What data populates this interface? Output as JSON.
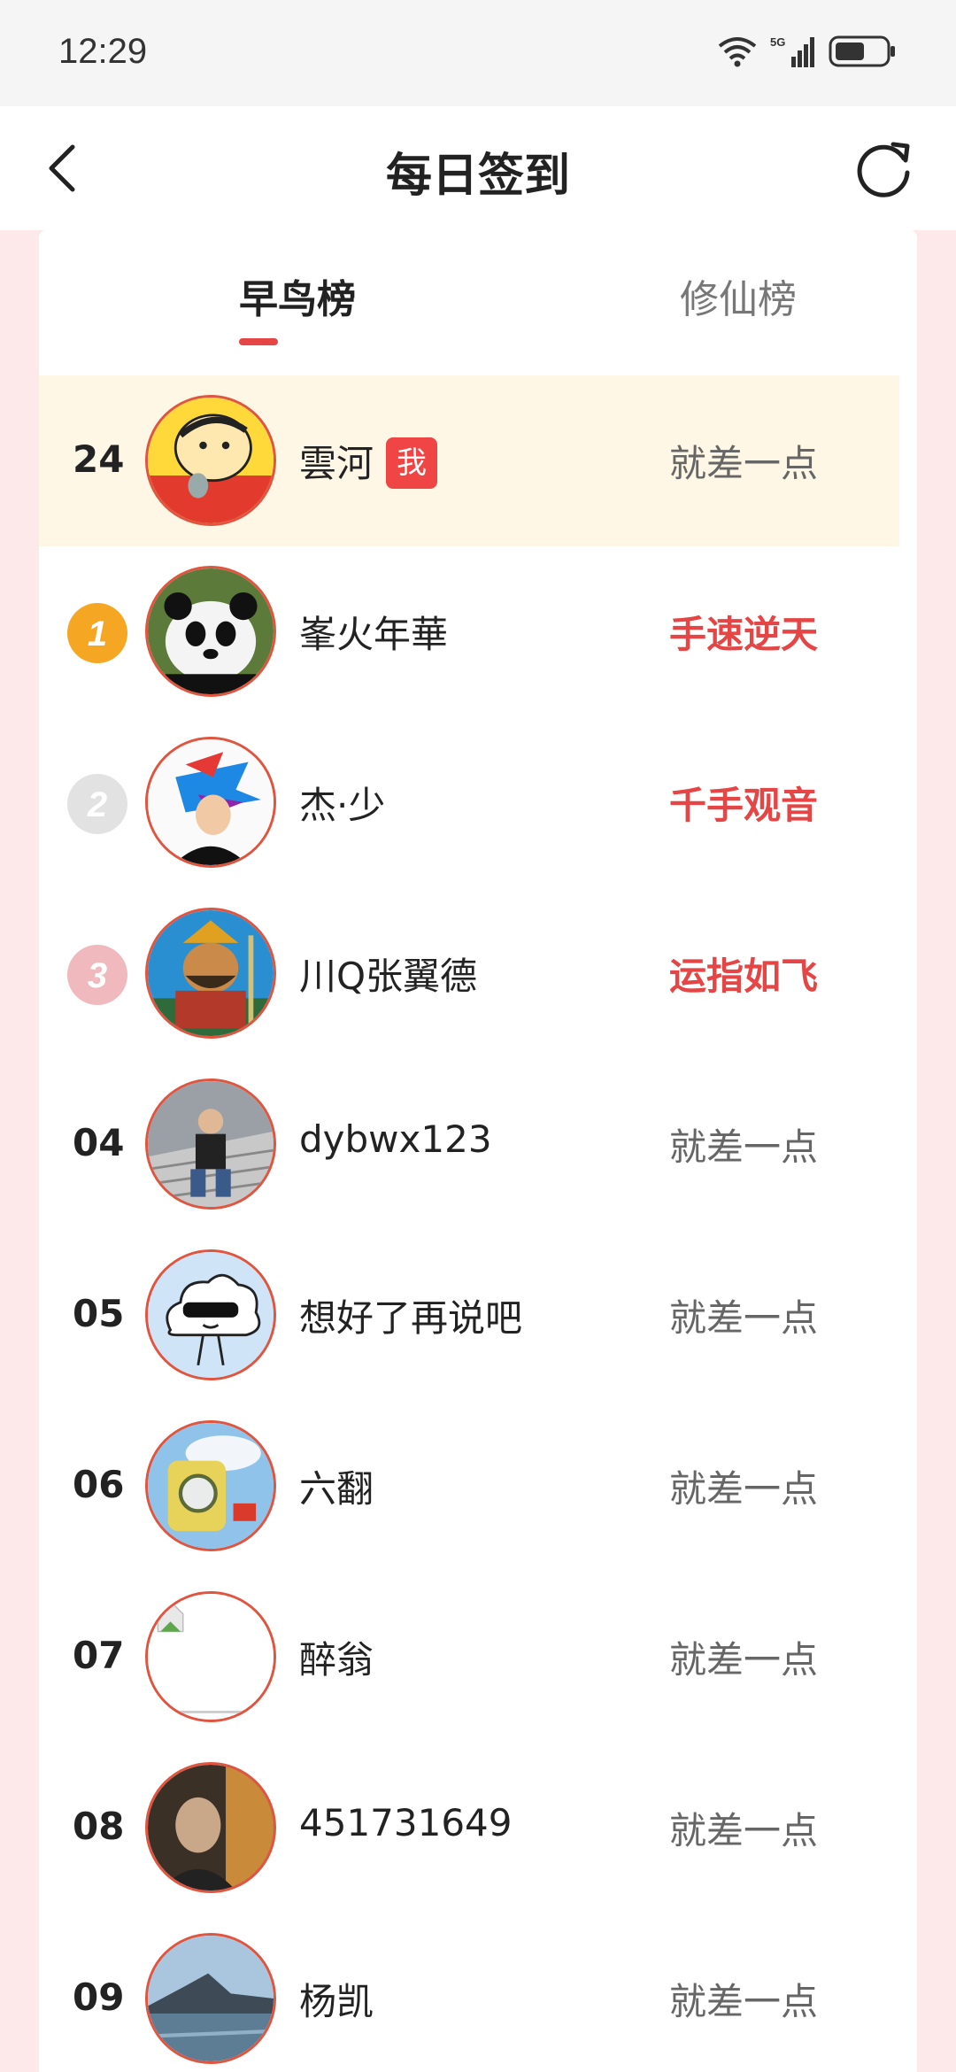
{
  "status_bar": {
    "time": "12:29",
    "network": "5G"
  },
  "header": {
    "title": "每日签到",
    "back_icon": "chevron-left-icon",
    "refresh_icon": "refresh-icon"
  },
  "tabs": [
    {
      "label": "早鸟榜",
      "active": true
    },
    {
      "label": "修仙榜",
      "active": false
    }
  ],
  "me_badge": "我",
  "rows": [
    {
      "rank": "24",
      "name": "雲河",
      "status": "就差一点",
      "is_me": true,
      "medal": null,
      "hot": false
    },
    {
      "rank": "1",
      "name": "峯火年華",
      "status": "手速逆天",
      "is_me": false,
      "medal": "gold",
      "hot": true
    },
    {
      "rank": "2",
      "name": "杰·少",
      "status": "千手观音",
      "is_me": false,
      "medal": "silver",
      "hot": true
    },
    {
      "rank": "3",
      "name": "川Q张翼德",
      "status": "运指如飞",
      "is_me": false,
      "medal": "bronze",
      "hot": true
    },
    {
      "rank": "04",
      "name": "dybwx123",
      "status": "就差一点",
      "is_me": false,
      "medal": null,
      "hot": false
    },
    {
      "rank": "05",
      "name": "想好了再说吧",
      "status": "就差一点",
      "is_me": false,
      "medal": null,
      "hot": false
    },
    {
      "rank": "06",
      "name": "六翻",
      "status": "就差一点",
      "is_me": false,
      "medal": null,
      "hot": false
    },
    {
      "rank": "07",
      "name": "醉翁",
      "status": "就差一点",
      "is_me": false,
      "medal": null,
      "hot": false
    },
    {
      "rank": "08",
      "name": "451731649",
      "status": "就差一点",
      "is_me": false,
      "medal": null,
      "hot": false
    },
    {
      "rank": "09",
      "name": "杨凯",
      "status": "就差一点",
      "is_me": false,
      "medal": null,
      "hot": false
    }
  ],
  "colors": {
    "accent": "#e64545",
    "highlight_row": "#fff7e6",
    "avatar_ring": "#e0553f"
  }
}
